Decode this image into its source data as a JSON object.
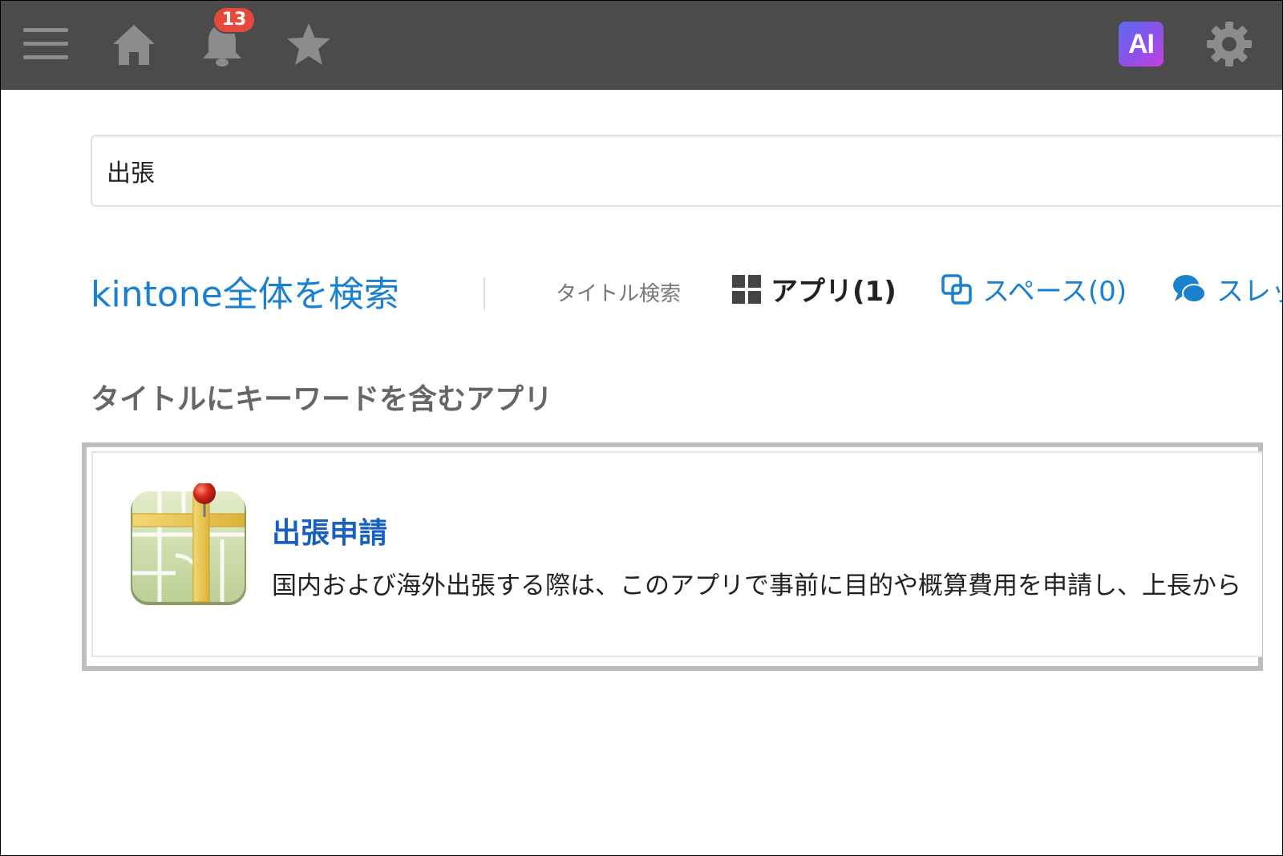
{
  "header": {
    "notifications_count": "13",
    "ai_label": "AI",
    "icons": [
      "menu-icon",
      "home-icon",
      "bell-icon",
      "star-icon",
      "gear-icon"
    ]
  },
  "search": {
    "value": "出張"
  },
  "scope": {
    "title": "kintone全体を検索",
    "filter_label": "タイトル検索",
    "tabs": [
      {
        "label": "アプリ(1)",
        "icon": "apps-grid-icon",
        "active": true
      },
      {
        "label": "スペース(0)",
        "icon": "space-icon",
        "active": false
      },
      {
        "label": "スレッ",
        "icon": "thread-icon",
        "active": false
      }
    ]
  },
  "results": {
    "heading": "タイトルにキーワードを含むアプリ",
    "items": [
      {
        "name": "出張申請",
        "description": "国内および海外出張する際は、このアプリで事前に目的や概算費用を申請し、上長から",
        "icon": "map-pin-app-icon"
      }
    ]
  },
  "colors": {
    "header_bg": "#4b4b4b",
    "link_blue": "#1a80d0",
    "badge_red": "#e8483c",
    "ai_gradient": [
      "#5a6cf2",
      "#c43fe0"
    ]
  }
}
